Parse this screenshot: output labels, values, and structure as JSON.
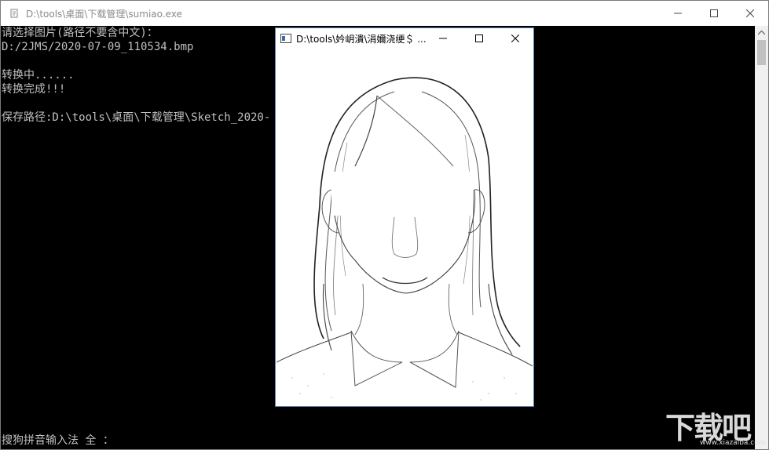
{
  "console": {
    "title": "D:\\tools\\桌面\\下载管理\\sumiao.exe",
    "lines": [
      "请选择图片(路径不要含中文)：",
      "D:/2JMS/2020-07-09_110534.bmp",
      "",
      "转换中......",
      "转换完成!!!",
      "",
      "保存路径:D:\\tools\\桌面\\下载管理\\Sketch_2020-"
    ],
    "ime_status": "搜狗拼音输入法 全 ："
  },
  "preview": {
    "title": "D:\\tools\\妗岄潰\\涓嬭浇绠＄ ..."
  },
  "watermark": {
    "text": "下载吧",
    "url": "www.xiazaiba.com"
  },
  "colors": {
    "console_bg": "#000000",
    "console_text": "#c0c0c0",
    "titlebar_text": "#8a8a8a",
    "preview_border": "#5a7fb0"
  }
}
